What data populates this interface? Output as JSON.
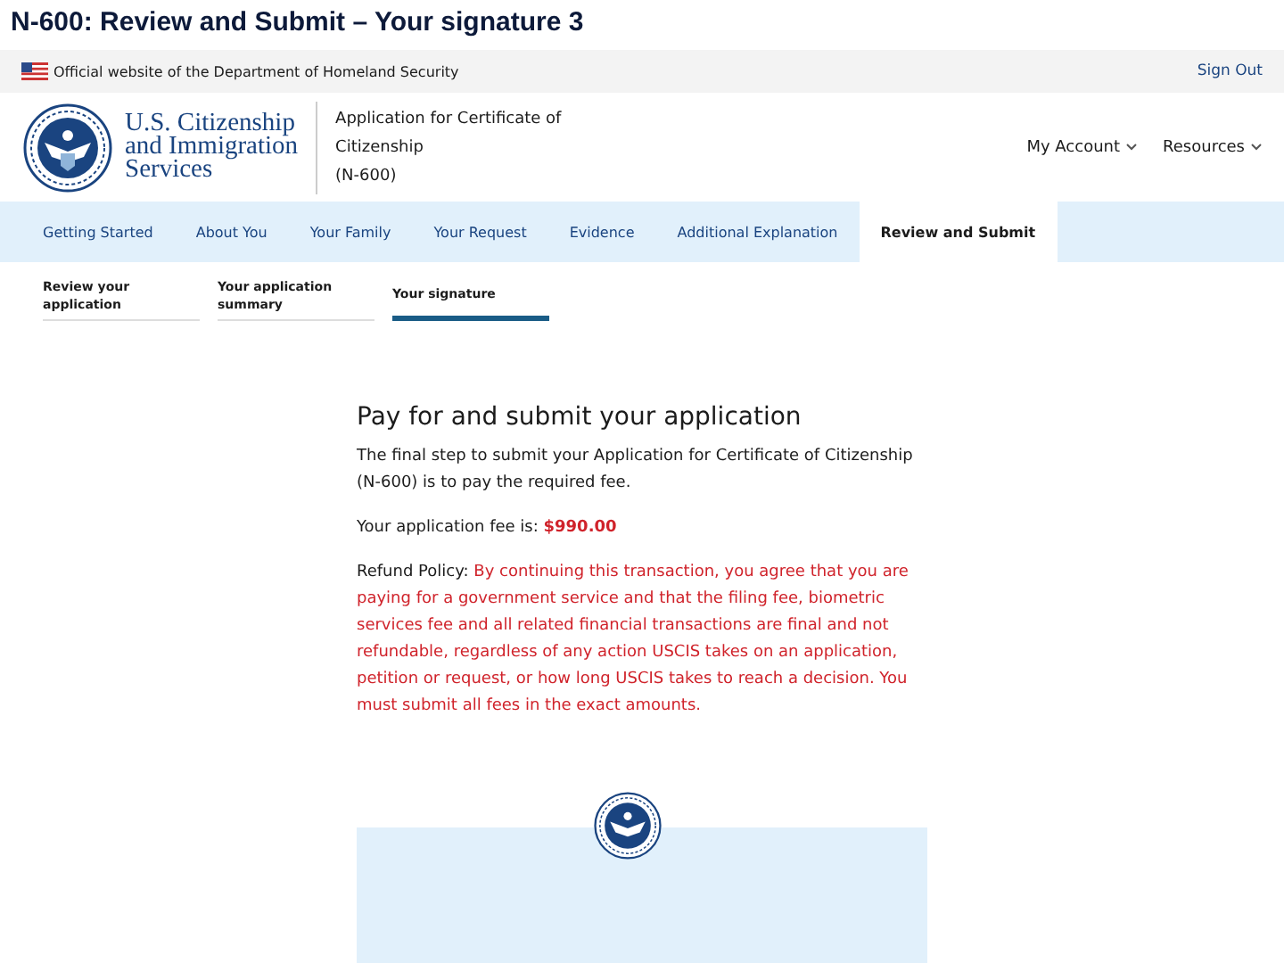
{
  "slide_title": "N-600: Review and Submit – Your signature 3",
  "banner": {
    "text": "Official website of the Department of Homeland Security",
    "link": "Sign Out"
  },
  "header": {
    "agency_lines": [
      "U.S. Citizenship",
      "and Immigration",
      "Services"
    ],
    "app_title_lines": [
      "Application for Certificate of",
      "Citizenship",
      "(N-600)"
    ],
    "menus": [
      {
        "label": "My Account"
      },
      {
        "label": "Resources"
      }
    ]
  },
  "tabs": [
    {
      "label": "Getting Started",
      "selected": false
    },
    {
      "label": "About You",
      "selected": false
    },
    {
      "label": "Your Family",
      "selected": false
    },
    {
      "label": "Your Request",
      "selected": false
    },
    {
      "label": "Evidence",
      "selected": false
    },
    {
      "label": "Additional Explanation",
      "selected": false
    },
    {
      "label": "Review and Submit",
      "selected": true
    }
  ],
  "subtabs": [
    {
      "label": "Review your application",
      "selected": false
    },
    {
      "label": "Your application summary",
      "selected": false
    },
    {
      "label": "Your signature",
      "selected": true
    }
  ],
  "content": {
    "heading": "Pay for and submit your application",
    "intro": "The final step to submit your Application for Certificate of Citizenship (N-600) is to pay the required fee.",
    "fee_label": "Your application fee is:",
    "fee_amount": "$990.00",
    "refund_label": "Refund Policy:",
    "refund_text": "By continuing this transaction, you agree that you are paying for a government service and that the filing fee, biometric services fee and all related financial transactions are final and not refundable, regardless of any action USCIS takes on an application, petition or request, or how long USCIS takes to reach a decision. You must submit all fees in the exact amounts."
  }
}
